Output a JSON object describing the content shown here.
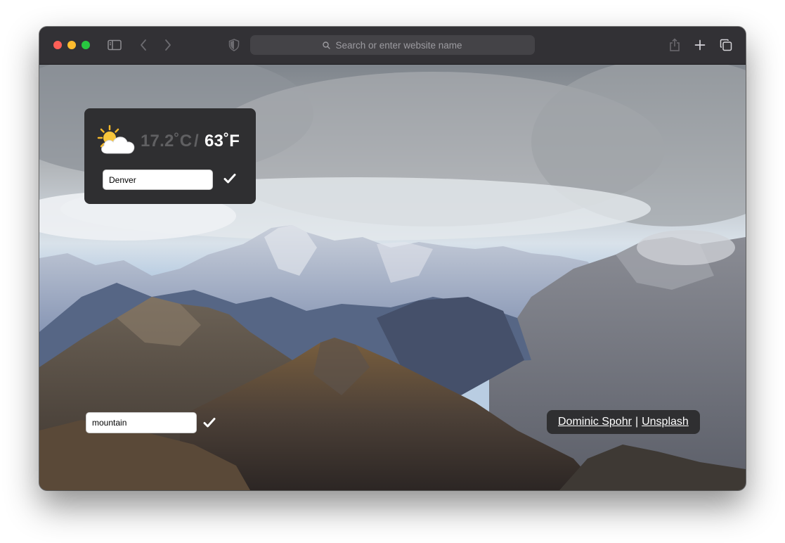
{
  "browser": {
    "address_placeholder": "Search or enter website name",
    "icons": [
      "sidebar-icon",
      "back-icon",
      "forward-icon",
      "shield-icon",
      "search-icon",
      "share-icon",
      "new-tab-icon",
      "tabs-overview-icon"
    ]
  },
  "weather": {
    "icon": "partly-sunny-icon",
    "temp_c": "17.2˚C",
    "separator": "/",
    "temp_f": "63˚F",
    "city_value": "Denver"
  },
  "background_search": {
    "value": "mountain"
  },
  "credit": {
    "author": "Dominic Spohr",
    "separator": "|",
    "source": "Unsplash"
  },
  "colors": {
    "card_bg": "#2f2f31",
    "temp_dim": "#606062",
    "temp_bright": "#ffffff",
    "toolbar_bg": "#323135"
  }
}
